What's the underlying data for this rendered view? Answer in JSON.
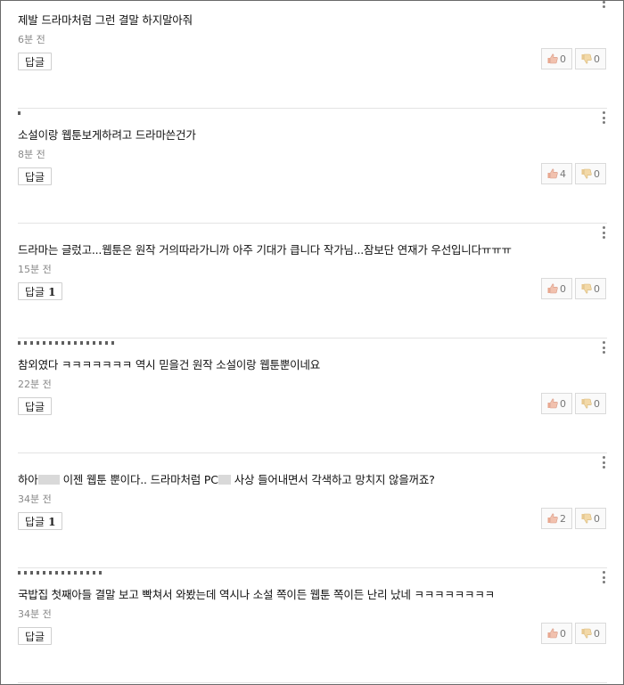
{
  "comments": [
    {
      "text": "제발 드라마처럼 그런 결말 하지말아줘",
      "time": "6분 전",
      "reply_label": "답글",
      "reply_count": "",
      "likes": "0",
      "dislikes": "0"
    },
    {
      "text": "소설이랑 웹툰보게하려고 드라마쓴건가",
      "time": "8분 전",
      "reply_label": "답글",
      "reply_count": "",
      "likes": "4",
      "dislikes": "0"
    },
    {
      "text": "드라마는 글렀고...웹툰은 원작 거의따라가니까 아주 기대가 큽니다 작가님...잠보단 연재가 우선입니다ㅠㅠㅠ",
      "time": "15분 전",
      "reply_label": "답글",
      "reply_count": "1",
      "likes": "0",
      "dislikes": "0"
    },
    {
      "text": "참외였다 ㅋㅋㅋㅋㅋㅋㅋ 역시 믿을건 원작 소설이랑 웹툰뿐이네요",
      "time": "22분 전",
      "reply_label": "답글",
      "reply_count": "",
      "likes": "0",
      "dislikes": "0"
    },
    {
      "text_a": "하아",
      "text_b": "이젠 웹툰 뿐이다.. 드라마처럼 PC",
      "text_c": "사상 들어내면서 각색하고 망치지 않을꺼죠?",
      "time": "34분 전",
      "reply_label": "답글",
      "reply_count": "1",
      "likes": "2",
      "dislikes": "0"
    },
    {
      "text": "국밥집 첫째아들 결말 보고 빡쳐서 와봤는데 역시나 소설 쪽이든 웹툰 쪽이든 난리 났네 ㅋㅋㅋㅋㅋㅋㅋㅋ",
      "time": "34분 전",
      "reply_label": "답글",
      "reply_count": "",
      "likes": "0",
      "dislikes": "0"
    }
  ],
  "icons": {
    "like": "thumbs-up-icon",
    "dislike": "thumbs-down-icon",
    "more": "more-vertical-icon"
  },
  "colors": {
    "border": "#6a6a6a",
    "divider": "#e3e3e3",
    "time": "#888888",
    "like_icon": "#e8a890",
    "dislike_icon": "#e8c890"
  }
}
